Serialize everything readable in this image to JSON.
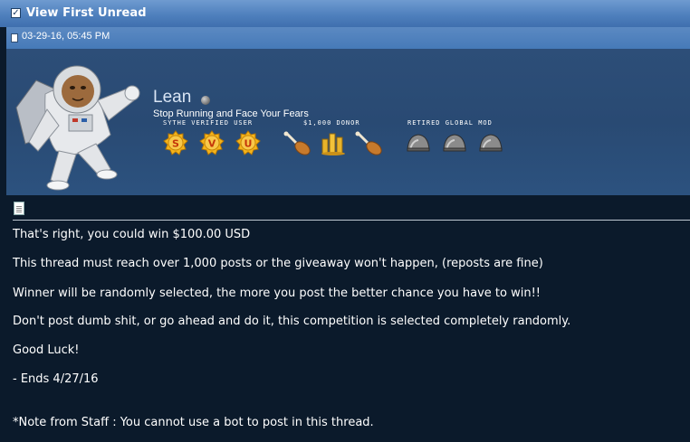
{
  "header": {
    "title": "View First Unread"
  },
  "post": {
    "date": "03-29-16, 05:45 PM",
    "author": {
      "username": "Lean",
      "user_title": "Stop Running and Face Your Fears",
      "online_status": "offline",
      "groups": [
        {
          "label": "SYTHE VERIFIED USER",
          "badges": [
            "S",
            "V",
            "U"
          ],
          "color": "#f5b41a"
        },
        {
          "label": "$1,000 DONOR",
          "badges": [
            "drumstick",
            "gold-coins",
            "drumstick"
          ],
          "color": "#c98a2a"
        },
        {
          "label": "RETIRED GLOBAL MOD",
          "badges": [
            "grey-helmet",
            "grey-helmet",
            "grey-helmet"
          ],
          "color": "#7a7a7a"
        }
      ]
    },
    "lines": [
      "That's right, you could win $100.00 USD",
      "This thread must reach over 1,000 posts or the giveaway won't happen, (reposts are fine)",
      "Winner will be randomly selected, the more you post the better chance you have to win!!",
      "Don't post dumb shit, or go ahead and do it, this competition is selected completely randomly.",
      "Good Luck!",
      "- Ends 4/27/16",
      "*Note from Staff : You cannot use a bot to post in this thread."
    ]
  },
  "colors": {
    "header_blue": "#4f80bd",
    "profile_bg": "#2d4e78",
    "content_bg": "#0b1a2b"
  }
}
